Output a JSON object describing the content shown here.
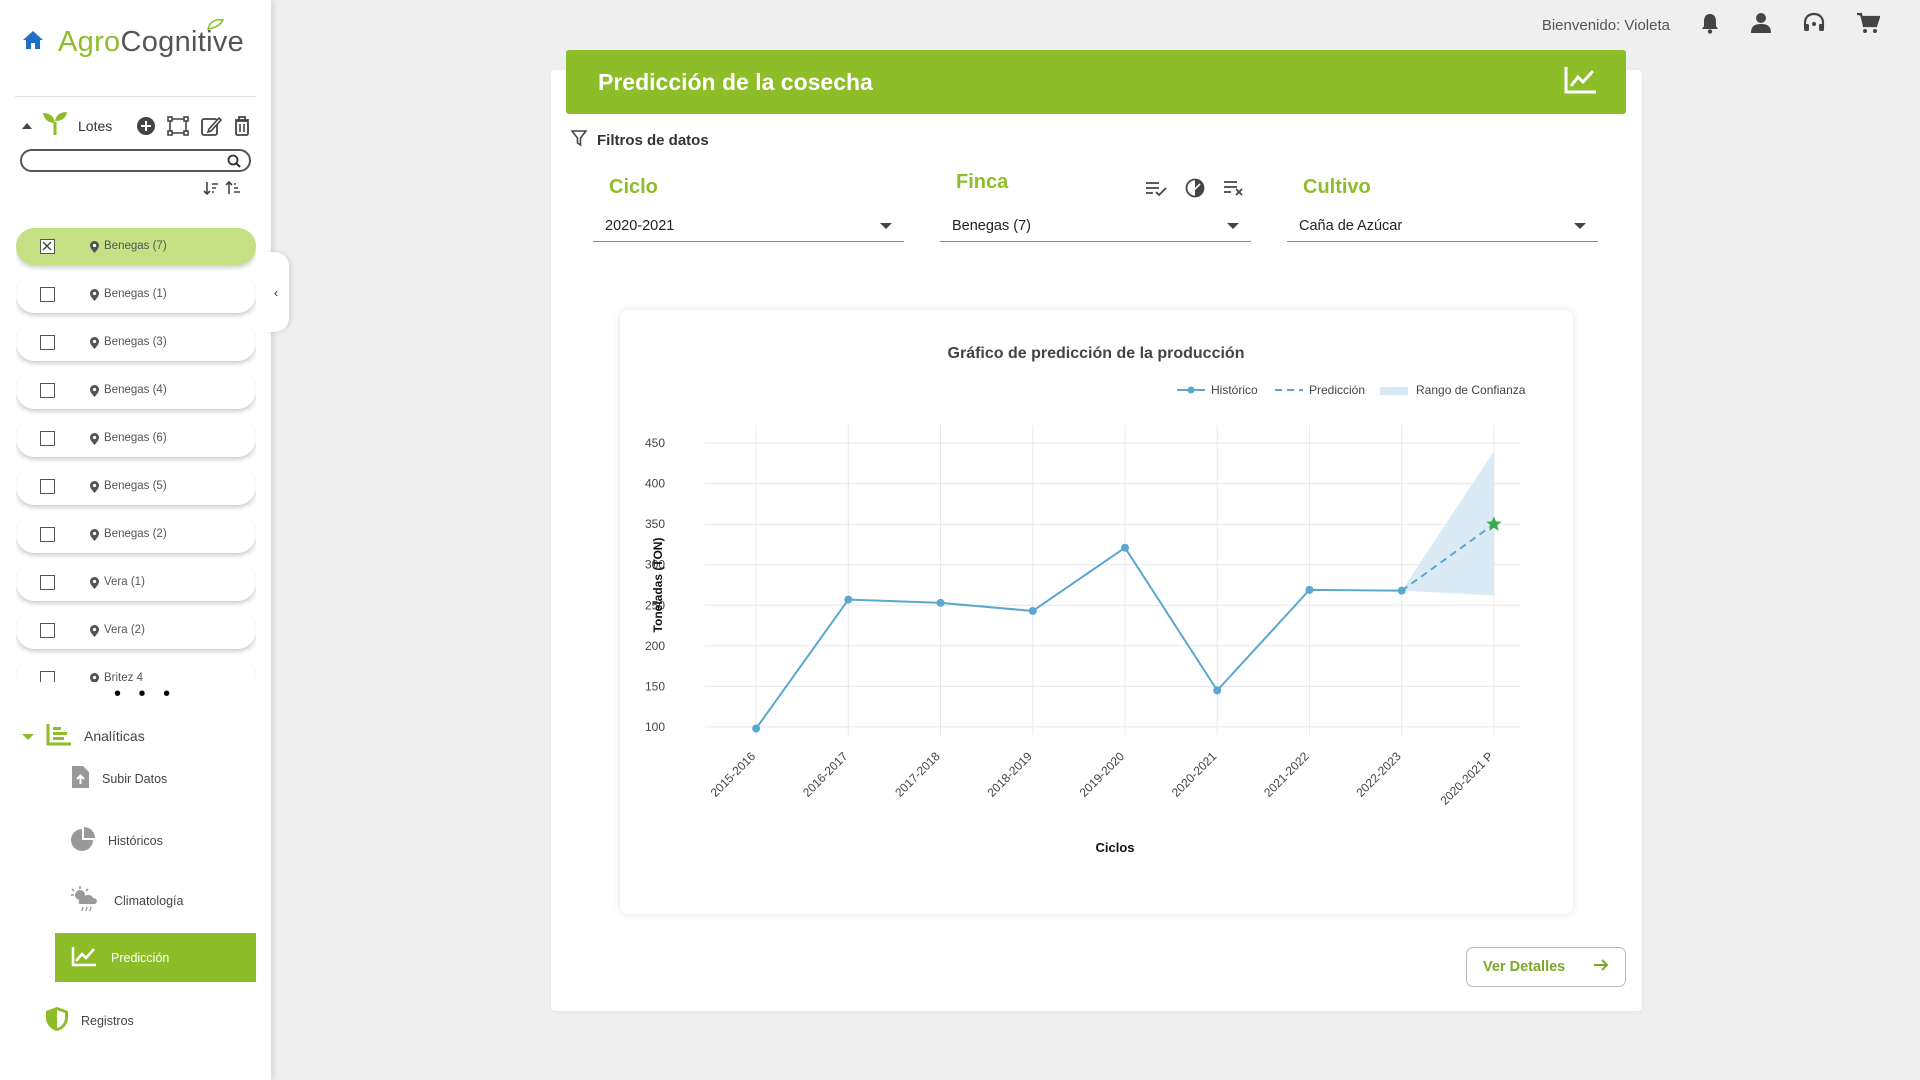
{
  "app": {
    "logo_part1": "Agro",
    "logo_part2": "Cognitive",
    "brand_color": "#8dbe2a"
  },
  "topbar": {
    "welcome": "Bienvenido: Violeta",
    "icons": [
      "bell-icon",
      "user-icon",
      "headset-icon",
      "cart-icon"
    ]
  },
  "sidebar": {
    "lotes_label": "Lotes",
    "search_placeholder": "",
    "lots": [
      {
        "name": "Benegas (7)",
        "checked": true
      },
      {
        "name": "Benegas (1)",
        "checked": false
      },
      {
        "name": "Benegas (3)",
        "checked": false
      },
      {
        "name": "Benegas (4)",
        "checked": false
      },
      {
        "name": "Benegas (6)",
        "checked": false
      },
      {
        "name": "Benegas (5)",
        "checked": false
      },
      {
        "name": "Benegas (2)",
        "checked": false
      },
      {
        "name": "Vera (1)",
        "checked": false
      },
      {
        "name": "Vera (2)",
        "checked": false
      },
      {
        "name": "Britez 4",
        "checked": false
      }
    ],
    "more_indicator": "• • •",
    "analiticas_label": "Analíticas",
    "subitems": {
      "subir": "Subir Datos",
      "historicos": "Históricos",
      "climatologia": "Climatología",
      "prediccion": "Predicción"
    },
    "registros_label": "Registros"
  },
  "main": {
    "title": "Predicción de la cosecha",
    "filters_title": "Filtros de datos",
    "filters": {
      "ciclo": {
        "label": "Ciclo",
        "value": "2020-2021"
      },
      "finca": {
        "label": "Finca",
        "value": "Benegas (7)"
      },
      "cultivo": {
        "label": "Cultivo",
        "value": "Caña de Azúcar"
      }
    },
    "details_button": "Ver Detalles"
  },
  "chart_data": {
    "type": "line",
    "title": "Gráfico de predicción de la producción",
    "xlabel": "Ciclos",
    "ylabel": "Toneladas (TON)",
    "categories": [
      "2015-2016",
      "2016-2017",
      "2017-2018",
      "2018-2019",
      "2019-2020",
      "2020-2021",
      "2021-2022",
      "2022-2023",
      "2020-2021 P"
    ],
    "series": [
      {
        "name": "Histórico",
        "values": [
          98,
          257,
          253,
          243,
          321,
          145,
          269,
          268,
          null
        ],
        "color": "#5aa7cf"
      },
      {
        "name": "Predicción",
        "values": [
          null,
          null,
          null,
          null,
          null,
          null,
          null,
          268,
          350
        ],
        "color": "#5aa7cf",
        "dashed": true
      }
    ],
    "confidence": {
      "name": "Rango de Confianza",
      "start_index": 7,
      "start_value": 268,
      "end_index": 8,
      "upper": 440,
      "lower": 262,
      "color": "#d5e8f4"
    },
    "prediction_marker_color": "#3daa4a",
    "yticks": [
      100,
      150,
      200,
      250,
      300,
      350,
      400,
      450
    ],
    "ylim": [
      90,
      460
    ],
    "grid": true,
    "legend_position": "top-right"
  }
}
